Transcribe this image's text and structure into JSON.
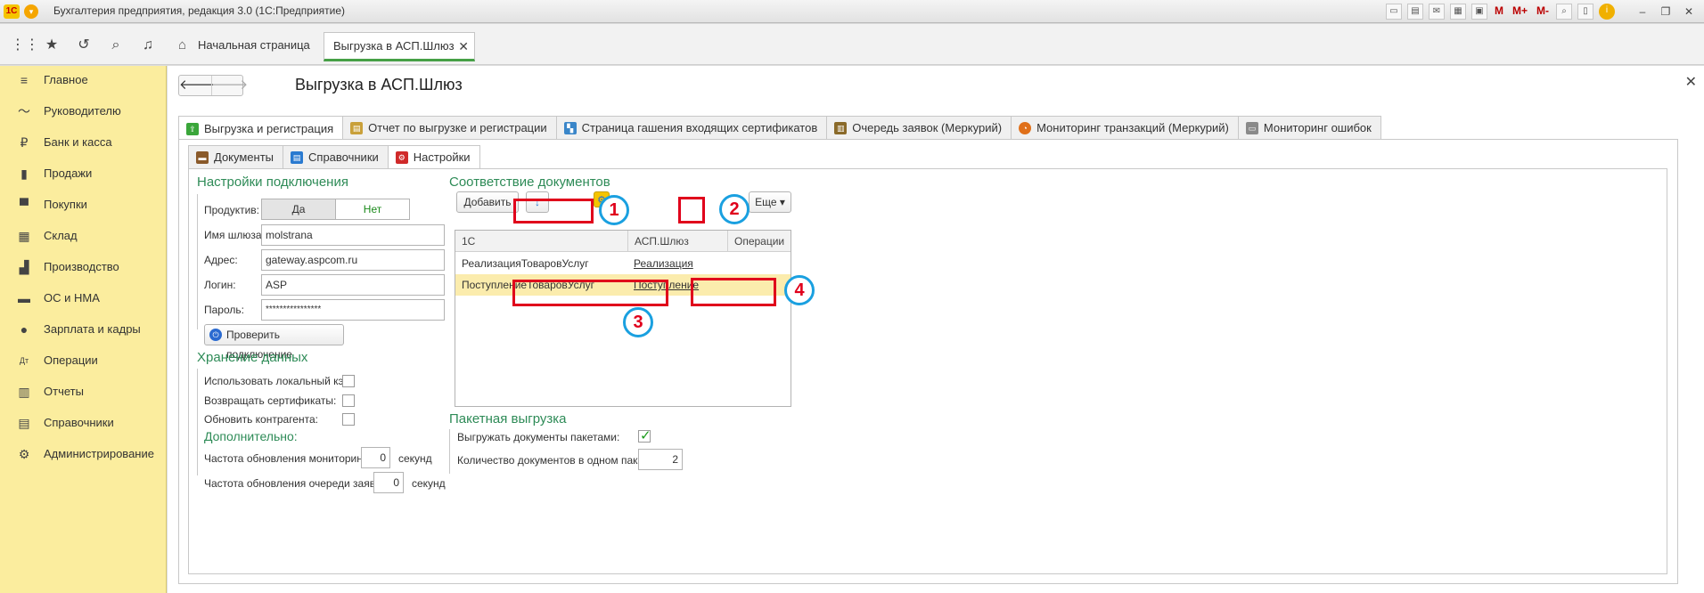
{
  "window": {
    "title": "Бухгалтерия предприятия, редакция 3.0  (1С:Предприятие)",
    "logo_text": "1С",
    "toolbar_m": [
      "M",
      "M+",
      "M-"
    ],
    "toolbar_icons": [
      "save-icon",
      "print-icon",
      "mail-icon",
      "calendar-icon",
      "calculator-icon",
      "zoom-icon",
      "layout-icon",
      "info-icon"
    ]
  },
  "topbar": {
    "home_tab": "Начальная страница",
    "active_tab": "Выгрузка в АСП.Шлюз"
  },
  "sidebar": {
    "items": [
      {
        "label": "Главное",
        "icon": "≡"
      },
      {
        "label": "Руководителю",
        "icon": "〜"
      },
      {
        "label": "Банк и касса",
        "icon": "₽"
      },
      {
        "label": "Продажи",
        "icon": "▮"
      },
      {
        "label": "Покупки",
        "icon": "▀"
      },
      {
        "label": "Склад",
        "icon": "▦"
      },
      {
        "label": "Производство",
        "icon": "▟"
      },
      {
        "label": "ОС и НМА",
        "icon": "▬"
      },
      {
        "label": "Зарплата и кадры",
        "icon": "●"
      },
      {
        "label": "Операции",
        "icon": "Дт"
      },
      {
        "label": "Отчеты",
        "icon": "▥"
      },
      {
        "label": "Справочники",
        "icon": "▤"
      },
      {
        "label": "Администрирование",
        "icon": "⚙"
      }
    ]
  },
  "page": {
    "title": "Выгрузка в АСП.Шлюз",
    "tabs": [
      {
        "label": "Выгрузка и регистрация",
        "color": "#3aa63a"
      },
      {
        "label": "Отчет по выгрузке и регистрации",
        "color": "#c9a03a"
      },
      {
        "label": "Страница гашения входящих сертификатов",
        "color": "#3a86c9"
      },
      {
        "label": "Очередь заявок (Меркурий)",
        "color": "#8a6a2a"
      },
      {
        "label": "Мониторинг транзакций (Меркурий)",
        "color": "#e0701a"
      },
      {
        "label": "Мониторинг ошибок",
        "color": "#8a8a8a"
      }
    ],
    "subtabs": [
      {
        "label": "Документы",
        "color": "#8a5a2a"
      },
      {
        "label": "Справочники",
        "color": "#2a7ad0"
      },
      {
        "label": "Настройки",
        "color": "#d02a2a"
      }
    ]
  },
  "connection": {
    "title": "Настройки подключения",
    "productive_label": "Продуктив:",
    "yes": "Да",
    "no": "Нет",
    "gateway_label": "Имя шлюза:",
    "gateway_value": "molstrana",
    "address_label": "Адрес:",
    "address_value": "gateway.aspcom.ru",
    "login_label": "Логин:",
    "login_value": "ASP",
    "password_label": "Пароль:",
    "password_value": "****************",
    "check_button": "Проверить подключение"
  },
  "storage": {
    "title": "Хранение данных",
    "local_cache_label": "Использовать локальный кэш:",
    "return_certs_label": "Возвращать сертификаты:",
    "update_contractor_label": "Обновить контрагента:"
  },
  "extra": {
    "title": "Дополнительно:",
    "monitoring_freq_label": "Частота обновления мониторинга:",
    "monitoring_freq_value": "0",
    "queue_freq_label": "Частота обновления очереди заявок:",
    "queue_freq_value": "0",
    "seconds": "секунд"
  },
  "mapping": {
    "title": "Соответствие документов",
    "add_button": "Добавить",
    "more_button": "Еще",
    "columns": [
      "1С",
      "АСП.Шлюз",
      "Операции"
    ],
    "rows": [
      {
        "c1": "РеализацияТоваровУслуг",
        "c2": "Реализация",
        "c3": ""
      },
      {
        "c1": "ПоступлениеТоваровУслуг",
        "c2": "Поступление",
        "c3": ""
      }
    ]
  },
  "batch": {
    "title": "Пакетная выгрузка",
    "batch_label": "Выгружать документы пакетами:",
    "batch_checked": true,
    "count_label": "Количество документов в одном пакете:",
    "count_value": "2"
  },
  "annotations": [
    "1",
    "2",
    "3",
    "4"
  ]
}
